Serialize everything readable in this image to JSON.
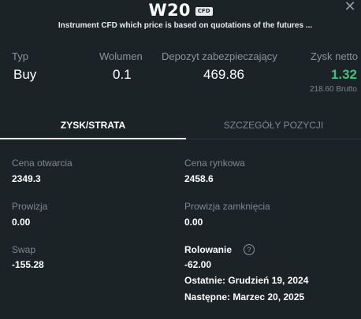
{
  "header": {
    "title": "W20",
    "badge": "CFD",
    "subtitle": "Instrument CFD which price is based on quotations of the futures ...",
    "close_icon": "close-icon"
  },
  "summary": {
    "type": {
      "label": "Typ",
      "value": "Buy"
    },
    "volume": {
      "label": "Wolumen",
      "value": "0.1"
    },
    "margin": {
      "label": "Depozyt zabezpieczający",
      "value": "469.86"
    },
    "net_profit": {
      "label": "Zysk netto",
      "value": "1.32",
      "gross": "218.60 Brutto"
    }
  },
  "tabs": {
    "profit_loss": "ZYSK/STRATA",
    "position_details": "SZCZEGÓŁY POZYCJI"
  },
  "details": {
    "open_price": {
      "label": "Cena otwarcia",
      "value": "2349.3"
    },
    "market_price": {
      "label": "Cena rynkowa",
      "value": "2458.6"
    },
    "commission": {
      "label": "Prowizja",
      "value": "0.00"
    },
    "close_commission": {
      "label": "Prowizja zamknięcia",
      "value": "0.00"
    },
    "swap": {
      "label": "Swap",
      "value": "-155.28"
    },
    "rollover": {
      "label": "Rolowanie",
      "value": "-62.00",
      "last": "Ostatnie: Grudzień 19, 2024",
      "next": "Następne: Marzec 20, 2025",
      "info_icon": "?"
    }
  },
  "colors": {
    "background": "#1c2327",
    "positive": "#3fc27c",
    "muted": "#7d888e"
  }
}
